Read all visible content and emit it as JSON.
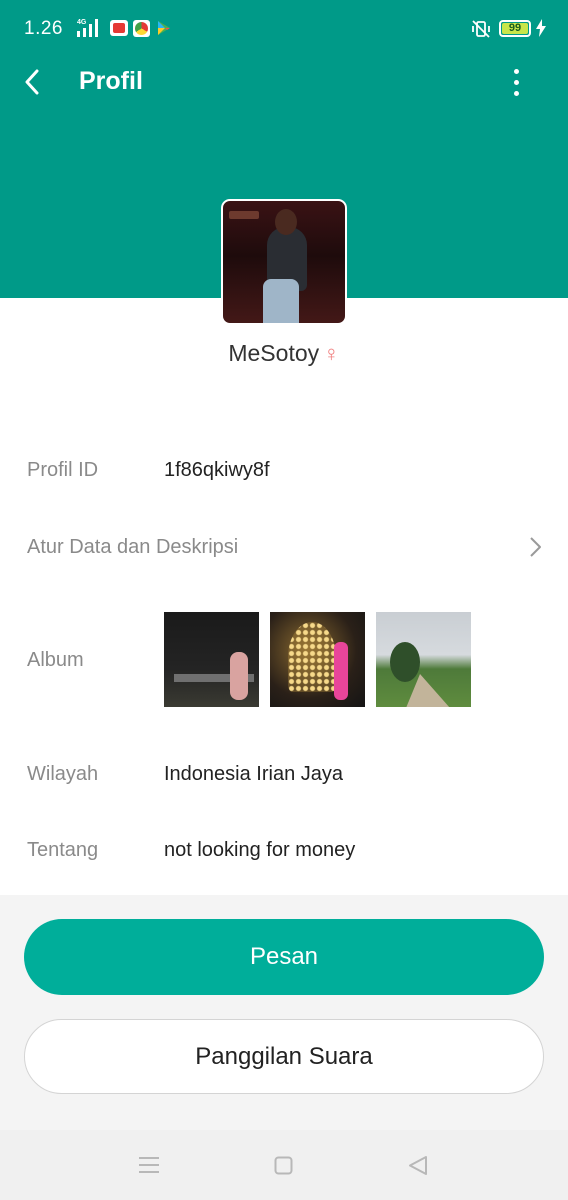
{
  "status_bar": {
    "time": "1.26",
    "network": "4G",
    "battery": "99",
    "battery_level": 0.99
  },
  "header": {
    "title": "Profil"
  },
  "profile": {
    "name": "MeSotoy",
    "gender_symbol": "♀"
  },
  "details": {
    "profile_id_label": "Profil ID",
    "profile_id_value": "1f86qkiwy8f",
    "edit_label": "Atur Data dan Deskripsi",
    "album_label": "Album",
    "region_label": "Wilayah",
    "region_value": "Indonesia Irian Jaya",
    "about_label": "Tentang",
    "about_value": "not looking for money"
  },
  "actions": {
    "message_label": "Pesan",
    "voice_call_label": "Panggilan Suara"
  },
  "colors": {
    "header": "#009a88",
    "primary_button": "#00ae9a",
    "gender": "#f08080"
  }
}
